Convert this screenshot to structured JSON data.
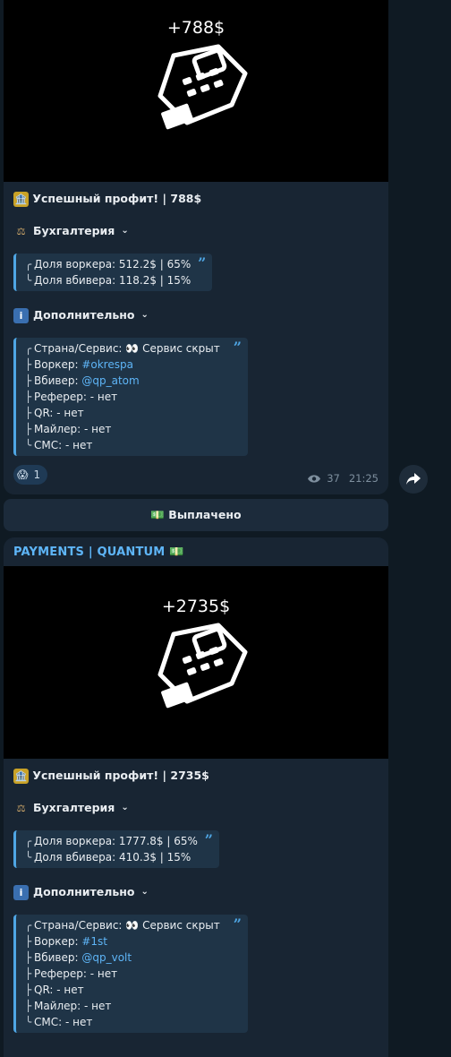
{
  "message1": {
    "amount": "+788$",
    "title": "Успешный профит! | 788$",
    "section1": "Бухгалтерия",
    "worker_share": "Доля воркера: 512.2$ | 65%",
    "knock_share": "Доля вбивера: 118.2$ | 15%",
    "section2": "Дополнительно",
    "country_label": "Страна/Сервис:",
    "country_value": "Сервис скрыт",
    "worker_label": "Воркер:",
    "worker_value": "#okrespa",
    "knocker_label": "Вбивер:",
    "knocker_value": "@qp_atom",
    "referrer": "Реферер: - нет",
    "qr": "QR: - нет",
    "mailer": "Майлер: - нет",
    "sms": "СМС: - нет",
    "reaction_count": "1",
    "views": "37",
    "time": "21:25"
  },
  "paid_button": "Выплачено",
  "message2": {
    "sender": "PAYMENTS | QUANTUM",
    "amount": "+2735$",
    "title": "Успешный профит! | 2735$",
    "section1": "Бухгалтерия",
    "worker_share": "Доля воркера: 1777.8$ | 65%",
    "knock_share": "Доля вбивера: 410.3$ | 15%",
    "section2": "Дополнительно",
    "country_label": "Страна/Сервис:",
    "country_value": "Сервис скрыт",
    "worker_label": "Воркер:",
    "worker_value": "#1st",
    "knocker_label": "Вбивер:",
    "knocker_value": "@qp_volt",
    "referrer": "Реферер: - нет",
    "qr": "QR: - нет",
    "mailer": "Майлер: - нет",
    "sms": "СМС: - нет"
  },
  "icons": {
    "bank": "bank-emoji-icon",
    "scales": "scales-emoji-icon",
    "info": "info-emoji-icon",
    "eyes": "eyes-emoji-icon",
    "scream": "scream-emoji-icon",
    "money": "money-emoji-icon",
    "view": "eye-icon",
    "share": "share-arrow-icon"
  },
  "colors": {
    "bubble": "#182533",
    "accent": "#5eb5f7",
    "background": "#0f1a23"
  }
}
